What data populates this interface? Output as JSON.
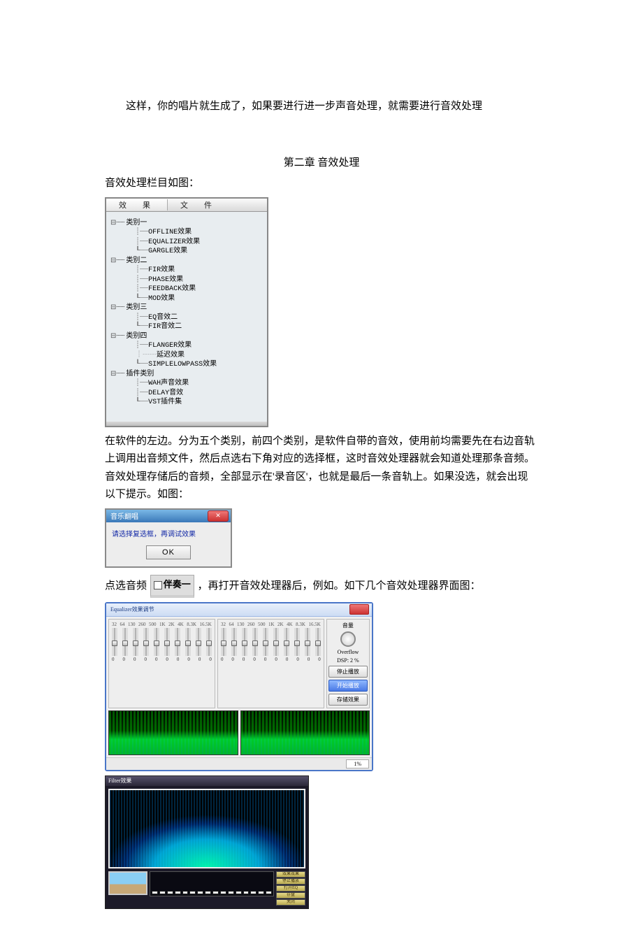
{
  "para1": "这样，你的唱片就生成了，如果要进行进一步声音处理，就需要进行音效处理",
  "chapter": "第二章 音效处理",
  "para2": "音效处理栏目如图：",
  "tree": {
    "tab1": "效　果",
    "tab2": "文　件",
    "cat1": "类别一",
    "cat1_items": [
      "OFFLINE效果",
      "EQUALIZER效果",
      "GARGLE效果"
    ],
    "cat2": "类别二",
    "cat2_items": [
      "FIR效果",
      "PHASE效果",
      "FEEDBACK效果",
      "MOD效果"
    ],
    "cat3": "类别三",
    "cat3_items": [
      "EQ音效二",
      "FIR音效二"
    ],
    "cat4": "类别四",
    "cat4_items": [
      "FLANGER效果",
      "延迟效果",
      "SIMPLELOWPASS效果"
    ],
    "cat5": "插件类别",
    "cat5_items": [
      "WAH声音效果",
      "DELAY音效",
      "VST插件集"
    ]
  },
  "para3": "在软件的左边。分为五个类别，前四个类别，是软件自带的音效，使用前均需要先在右边音轨上调用出音频文件，然后点选右下角对应的选择框，这时音效处理器就会知道处理那条音频。音效处理存储后的音频，全部显示在'录音区'，也就是最后一条音轨上。如果没选，就会出现以下提示。如图：",
  "dialog": {
    "title": "音乐翻唱",
    "msg": "请选择复选框，再调试效果",
    "ok": "OK"
  },
  "para4_a": "点选音频",
  "accompaniment": "伴奏一",
  "para4_b": "，再打开音效处理器后，例如。如下几个音效处理器界面图：",
  "eq": {
    "title": "Equalizer效果调节",
    "freqs": [
      "32",
      "64",
      "130",
      "260",
      "500",
      "1K",
      "2K",
      "4K",
      "8.3K",
      "16.5K"
    ],
    "vals": [
      "0",
      "0",
      "0",
      "0",
      "0",
      "0",
      "0",
      "0",
      "0",
      "0"
    ],
    "vol": "音量",
    "overflow": "Overflow",
    "dsp": "DSP: 2 %",
    "stop": "停止播放",
    "start": "开始播放",
    "save": "存储效果",
    "percent": "1%"
  },
  "filter": {
    "title": "Filter效果",
    "btns": [
      "效果效果",
      "停止播放",
      "打开EQ",
      "存盘",
      "关闭"
    ]
  }
}
